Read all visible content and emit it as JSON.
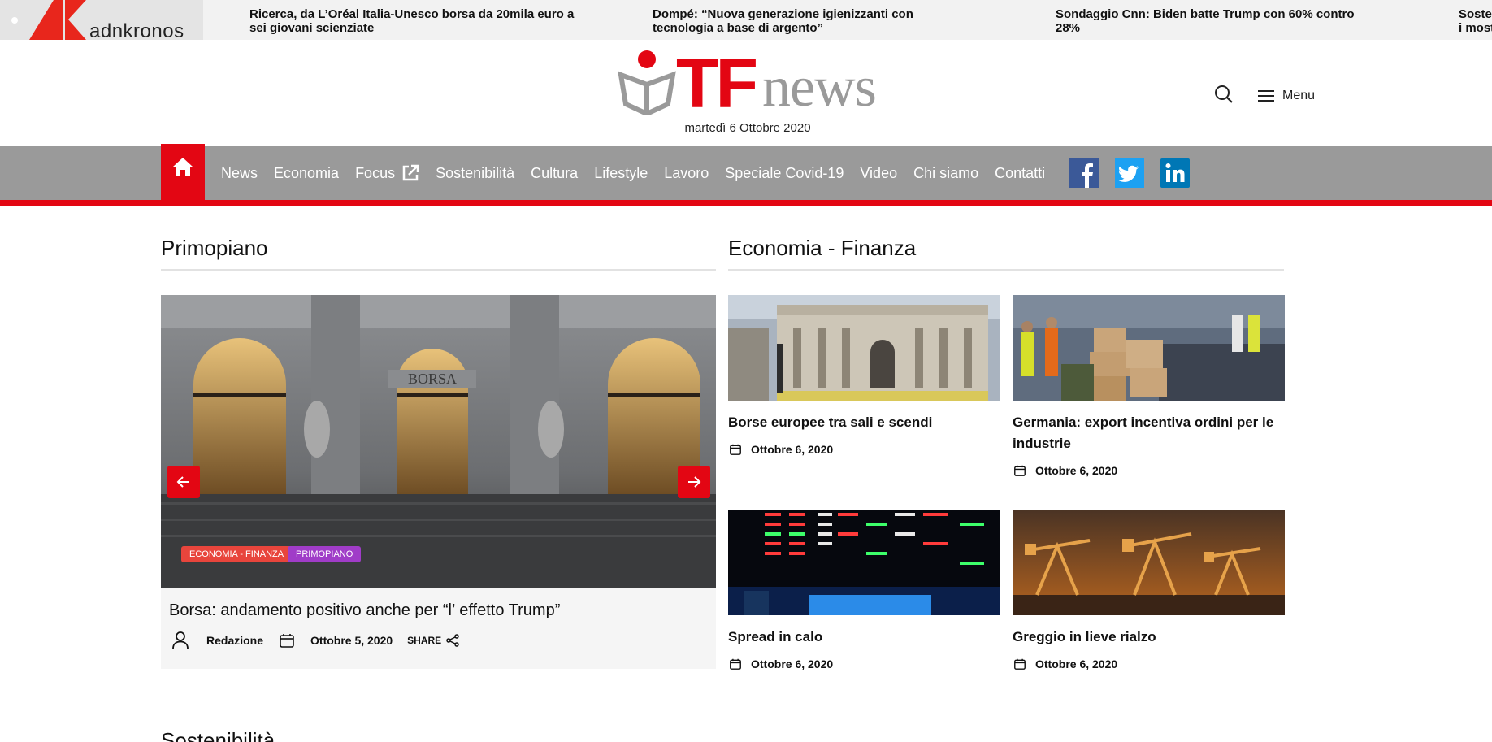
{
  "ticker": {
    "logo_text": "adnkronos",
    "items": [
      "Ricerca, da L’Oréal Italia-Unesco borsa da 20mila euro a sei giovani scienziate",
      "Dompé: “Nuova generazione igienizzanti con tecnologia a base di argento”",
      "Sondaggio Cnn: Biden batte Trump con 60% contro 28%",
      "Sosteni mostr"
    ]
  },
  "masthead": {
    "logo_tf": "TF",
    "logo_news": "news",
    "date": "martedì 6 Ottobre 2020",
    "menu_label": "Menu"
  },
  "nav": {
    "items": [
      "News",
      "Economia",
      "Focus",
      "Sostenibilità",
      "Cultura",
      "Lifestyle",
      "Lavoro",
      "Speciale Covid-19",
      "Video",
      "Chi siamo",
      "Contatti"
    ]
  },
  "primopiano": {
    "title": "Primopiano",
    "hero": {
      "tags": [
        "ECONOMIA - FINANZA",
        "PRIMOPIANO"
      ],
      "headline": "Borsa: andamento positivo anche per “l’ effetto Trump”",
      "author": "Redazione",
      "date": "Ottobre 5, 2020",
      "share_label": "SHARE",
      "image_label": "BORSA"
    }
  },
  "economia": {
    "title": "Economia - Finanza",
    "cards": [
      {
        "title": "Borse europee tra sali e scendi",
        "date": "Ottobre 6, 2020"
      },
      {
        "title": "Germania: export incentiva ordini per le industrie",
        "date": "Ottobre 6, 2020"
      },
      {
        "title": "Spread in calo",
        "date": "Ottobre 6, 2020"
      },
      {
        "title": "Greggio in lieve rialzo",
        "date": "Ottobre 6, 2020"
      }
    ]
  },
  "next_section": "Sostenibilità",
  "colors": {
    "brand_red": "#e30613",
    "nav_gray": "#9a9a9a",
    "tag_red": "#e8453c",
    "tag_purple": "#a03cc8"
  }
}
